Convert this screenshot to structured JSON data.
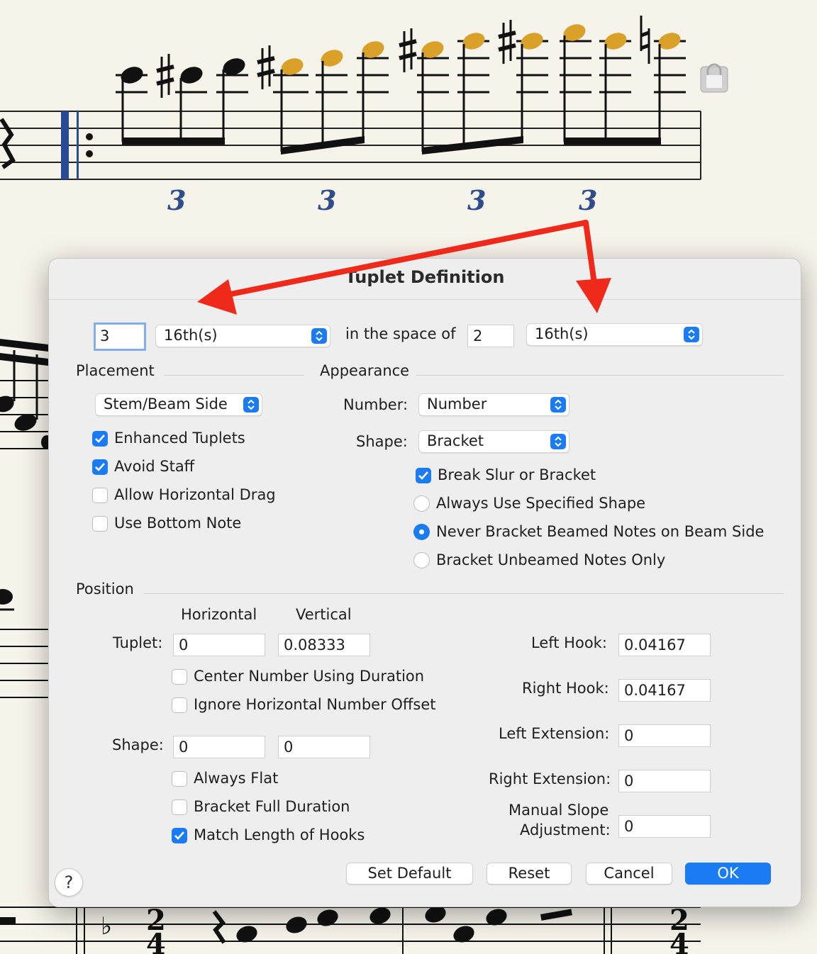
{
  "dialog": {
    "title": "Tuplet Definition",
    "tuplet_count": "3",
    "tuplet_unit": "16th(s)",
    "in_space_of_label": "in the space of",
    "space_count": "2",
    "space_unit": "16th(s)"
  },
  "placement": {
    "section_label": "Placement",
    "dropdown_value": "Stem/Beam Side",
    "checkboxes": [
      {
        "label": "Enhanced Tuplets",
        "checked": true
      },
      {
        "label": "Avoid Staff",
        "checked": true
      },
      {
        "label": "Allow Horizontal Drag",
        "checked": false
      },
      {
        "label": "Use Bottom Note",
        "checked": false
      }
    ]
  },
  "appearance": {
    "section_label": "Appearance",
    "number_label": "Number:",
    "number_value": "Number",
    "shape_label": "Shape:",
    "shape_value": "Bracket",
    "break_slur_label": "Break Slur or Bracket",
    "break_slur_checked": true,
    "radios": [
      {
        "label": "Always Use Specified Shape",
        "selected": false
      },
      {
        "label": "Never Bracket Beamed Notes on Beam Side",
        "selected": true
      },
      {
        "label": "Bracket Unbeamed Notes Only",
        "selected": false
      }
    ]
  },
  "position": {
    "section_label": "Position",
    "horizontal_label": "Horizontal",
    "vertical_label": "Vertical",
    "tuplet_label": "Tuplet:",
    "tuplet_h": "0",
    "tuplet_v": "0.08333",
    "center_number_label": "Center Number Using Duration",
    "center_number_checked": false,
    "ignore_offset_label": "Ignore Horizontal Number Offset",
    "ignore_offset_checked": false,
    "shape_label": "Shape:",
    "shape_h": "0",
    "shape_v": "0",
    "always_flat_label": "Always Flat",
    "always_flat_checked": false,
    "bracket_full_label": "Bracket Full Duration",
    "bracket_full_checked": false,
    "match_hooks_label": "Match Length of Hooks",
    "match_hooks_checked": true,
    "left_hook_label": "Left Hook:",
    "left_hook_value": "0.04167",
    "right_hook_label": "Right Hook:",
    "right_hook_value": "0.04167",
    "left_ext_label": "Left Extension:",
    "left_ext_value": "0",
    "right_ext_label": "Right Extension:",
    "right_ext_value": "0",
    "manual_slope_label_1": "Manual Slope",
    "manual_slope_label_2": "Adjustment:",
    "manual_slope_value": "0"
  },
  "buttons": {
    "help": "?",
    "set_default": "Set Default",
    "reset": "Reset",
    "cancel": "Cancel",
    "ok": "OK"
  },
  "score": {
    "tuplet_numbers": [
      "3",
      "3",
      "3",
      "3"
    ],
    "time_signature": [
      "2",
      "4"
    ]
  },
  "colors": {
    "accent": "#1a7bf2",
    "annotation_arrow": "#f02a1a",
    "tuplet_number": "#2f4d8c",
    "highlighted_note": "#d9a12a",
    "repeat_barline": "#264c96"
  }
}
